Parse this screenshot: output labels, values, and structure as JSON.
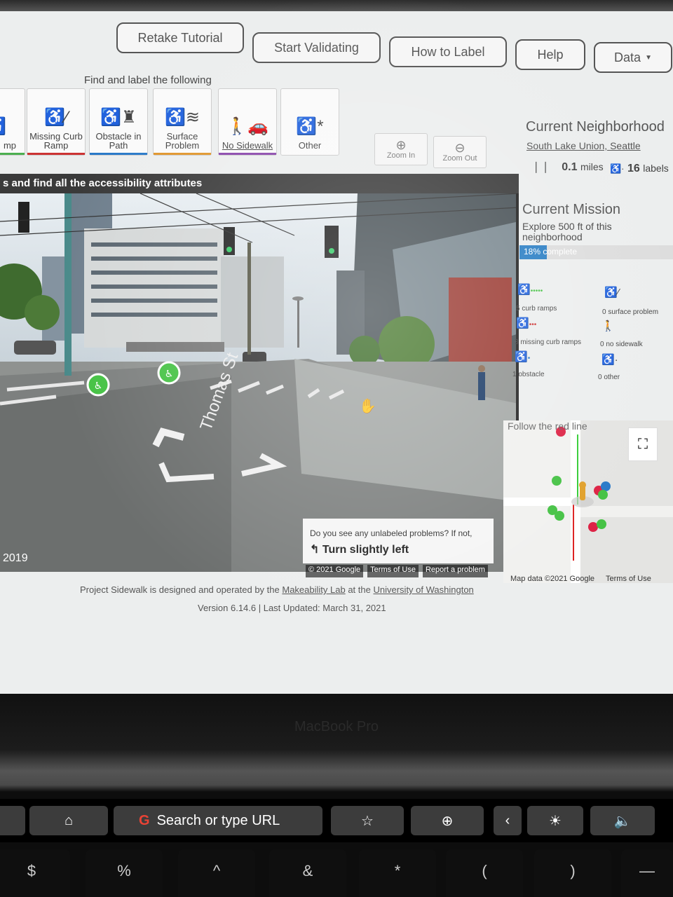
{
  "nav": {
    "buttons": [
      "Retake Tutorial",
      "Start Validating",
      "How to Label",
      "Help",
      "Data"
    ]
  },
  "toolbar": {
    "prompt": "Find and label the following",
    "tools": [
      {
        "label": "mp",
        "icon": "wheelchair-icon",
        "color": "#4caf50"
      },
      {
        "label": "Missing Curb Ramp",
        "icon": "wheelchair-icon",
        "color": "#cc3333"
      },
      {
        "label": "Obstacle in Path",
        "icon": "hydrant-icon",
        "color": "#2979c8"
      },
      {
        "label": "Surface Problem",
        "icon": "surface-icon",
        "color": "#e0952a"
      },
      {
        "label": "No Sidewalk",
        "icon": "pedestrian-car-icon",
        "color": "#8844aa"
      },
      {
        "label": "Other",
        "icon": "wheelchair-icon",
        "color": ""
      }
    ],
    "zoom_in": "Zoom In",
    "zoom_out": "Zoom Out"
  },
  "streetview": {
    "header": "s and find all the accessibility attributes",
    "year": "2019",
    "street_label": "Thomas St",
    "prompt_question": "Do you see any unlabeled problems? If not,",
    "prompt_direction": "Turn slightly left",
    "footer": [
      "© 2021 Google",
      "Terms of Use",
      "Report a problem"
    ]
  },
  "neighborhood": {
    "title": "Current Neighborhood",
    "name": "South Lake Union, Seattle",
    "miles": "0.1",
    "miles_unit": "miles",
    "labels": "16",
    "labels_unit": "labels"
  },
  "mission": {
    "title": "Current Mission",
    "description": "Explore 500 ft of this neighborhood",
    "progress_text": "18% complete",
    "progress": 0.18
  },
  "stats": [
    {
      "text": "5 curb ramps",
      "icon": "curb-ramp-icon"
    },
    {
      "text": "0 surface problem",
      "icon": "surface-problem-icon"
    },
    {
      "text": "3 missing curb ramps",
      "icon": "missing-curb-ramp-icon"
    },
    {
      "text": "0 no sidewalk",
      "icon": "no-sidewalk-icon"
    },
    {
      "text": "1 obstacle",
      "icon": "obstacle-icon"
    },
    {
      "text": "0 other",
      "icon": "other-icon"
    }
  ],
  "minimap": {
    "title": "Follow the red line",
    "footer": [
      "Map data ©2021 Google",
      "Terms of Use"
    ]
  },
  "footer": {
    "line1_prefix": "Project Sidewalk is designed and operated by the",
    "lab": "Makeability Lab",
    "line1_mid": "at the",
    "university": "University of Washington",
    "line2": "Version 6.14.6 | Last Updated: March 31, 2021"
  },
  "laptop": {
    "brand": "MacBook Pro",
    "touchbar_search": "Search or type URL",
    "keys": [
      "$",
      "%",
      "^",
      "&",
      "*",
      "(",
      ")",
      "—"
    ]
  }
}
